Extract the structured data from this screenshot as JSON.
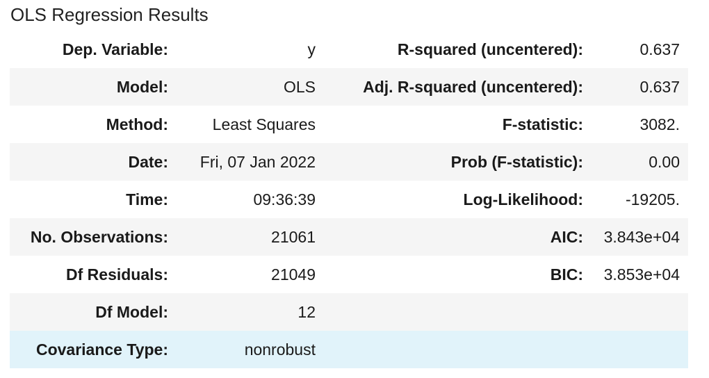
{
  "caption": "OLS Regression Results",
  "rows": [
    {
      "l_label": "Dep. Variable:",
      "l_value": "y",
      "r_label": "R-squared (uncentered):",
      "r_value": "0.637"
    },
    {
      "l_label": "Model:",
      "l_value": "OLS",
      "r_label": "Adj. R-squared (uncentered):",
      "r_value": "0.637"
    },
    {
      "l_label": "Method:",
      "l_value": "Least Squares",
      "r_label": "F-statistic:",
      "r_value": "3082."
    },
    {
      "l_label": "Date:",
      "l_value": "Fri, 07 Jan 2022",
      "r_label": "Prob (F-statistic):",
      "r_value": "0.00"
    },
    {
      "l_label": "Time:",
      "l_value": "09:36:39",
      "r_label": "Log-Likelihood:",
      "r_value": "-19205."
    },
    {
      "l_label": "No. Observations:",
      "l_value": "21061",
      "r_label": "AIC:",
      "r_value": "3.843e+04"
    },
    {
      "l_label": "Df Residuals:",
      "l_value": "21049",
      "r_label": "BIC:",
      "r_value": "3.853e+04"
    },
    {
      "l_label": "Df Model:",
      "l_value": "12",
      "r_label": "",
      "r_value": ""
    },
    {
      "l_label": "Covariance Type:",
      "l_value": "nonrobust",
      "r_label": "",
      "r_value": ""
    }
  ],
  "colors": {
    "stripe": "#f5f5f5",
    "hover_row": "#e1f3fa"
  }
}
